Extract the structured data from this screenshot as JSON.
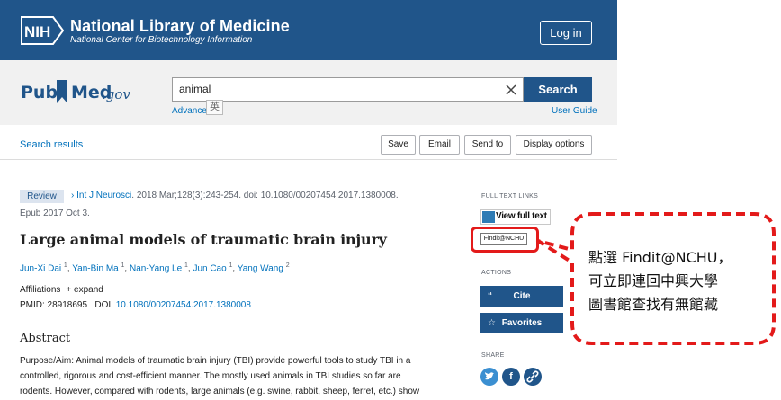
{
  "header": {
    "logo_text": "NIH",
    "title": "National Library of Medicine",
    "subtitle": "National Center for Biotechnology Information",
    "login_label": "Log in",
    "bar_color": "#20558a"
  },
  "search": {
    "logo_pub": "Pub",
    "logo_med": "Med",
    "logo_gov": ".gov",
    "query": "animal",
    "clear_icon": "close-icon",
    "button_label": "Search",
    "advanced_label": "Advanced",
    "ime_indicator": "英",
    "user_guide_label": "User Guide"
  },
  "toolbar": {
    "results_link": "Search results",
    "buttons": [
      "Save",
      "Email",
      "Send to",
      "Display options"
    ]
  },
  "article": {
    "type_badge": "Review",
    "journal": "Int J Neurosci",
    "citation": ". 2018 Mar;128(3):243-254. doi: 10.1080/00207454.2017.1380008.",
    "epub": "Epub 2017 Oct 3.",
    "title": "Large animal models of traumatic brain injury",
    "authors": [
      {
        "name": "Jun-Xi Dai",
        "aff": "1"
      },
      {
        "name": "Yan-Bin Ma",
        "aff": "1"
      },
      {
        "name": "Nan-Yang Le",
        "aff": "1"
      },
      {
        "name": "Jun Cao",
        "aff": "1"
      },
      {
        "name": "Yang Wang",
        "aff": "2"
      }
    ],
    "affiliations_label": "Affiliations",
    "expand_label": "+ expand",
    "pmid_label": "PMID: 28918695",
    "doi_label": "DOI:",
    "doi_value": "10.1080/00207454.2017.1380008",
    "abstract_heading": "Abstract",
    "abstract_lines": [
      "Purpose/Aim: Animal models of traumatic brain injury (TBI) provide powerful tools to study TBI in a",
      "controlled, rigorous and cost-efficient manner. The mostly used animals in TBI studies so far are",
      "rodents. However, compared with rodents, large animals (e.g. swine, rabbit, sheep, ferret, etc.) show"
    ]
  },
  "sidebar": {
    "full_text_heading": "FULL TEXT LINKS",
    "view_full_text": "View full text",
    "findit_label": "Findit@NCHU",
    "actions_heading": "ACTIONS",
    "cite_label": "Cite",
    "cite_icon": "quote-icon",
    "favorites_label": "Favorites",
    "favorites_icon": "star-icon",
    "share_heading": "SHARE",
    "share_icons": [
      "twitter-icon",
      "facebook-icon",
      "link-icon"
    ]
  },
  "callout": {
    "lines": [
      "點選 Findit@NCHU，",
      "可立即連回中興大學",
      "圖書館查找有無館藏"
    ],
    "border_color": "#e31a1a"
  }
}
